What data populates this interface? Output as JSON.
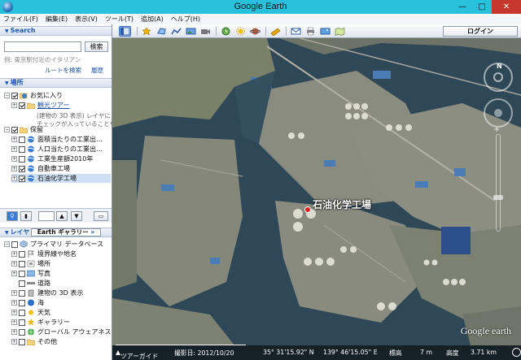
{
  "window": {
    "title": "Google Earth"
  },
  "menu": [
    "ファイル(F)",
    "編集(E)",
    "表示(V)",
    "ツール(T)",
    "追加(A)",
    "ヘルプ(H)"
  ],
  "toolbar": {
    "login_label": "ログイン"
  },
  "search": {
    "header": "Search",
    "button": "検索",
    "hint": "例: 東京駅付近のイタリアン",
    "route_link": "ルートを検索",
    "history_link": "履歴"
  },
  "places": {
    "header": "場所",
    "favorites": "お気に入り",
    "tour": "観光ツアー",
    "tour_desc1": "(建物の 3D 表示) レイヤに",
    "tour_desc2": "チェックが入っていることを",
    "saved": "保留",
    "items": [
      "面積当たりの工業出…",
      "人口当たりの工業出…",
      "工業生産額2010年",
      "自動車工場",
      "石油化学工場"
    ]
  },
  "layers": {
    "header": "レイヤ",
    "gallery_label": "Earth ギャラリー",
    "gallery_more": "»",
    "root": "プライマリ データベース",
    "items": [
      "境界線や地名",
      "場所",
      "写真",
      "道路",
      "建物の 3D 表示",
      "海",
      "天気",
      "ギャラリー",
      "グローバル アウェアネス",
      "その他"
    ]
  },
  "map": {
    "place_label": "石油化学工場",
    "brand": "Google earth",
    "status": {
      "tour_guide": "ツアーガイド",
      "imagery_date": "撮影日: 2012/10/20",
      "latitude": "35° 31'15.92\" N",
      "longitude": "139° 46'15.05\" E",
      "elevation_label": "標高",
      "elevation_value": "7 m",
      "eye_alt_label": "高度",
      "eye_alt_value": "3.71 km"
    }
  },
  "colors": {
    "titlebar": "#29c0dc",
    "close": "#c7372e",
    "link": "#1c4fa8",
    "header_text": "#1c58b8"
  }
}
